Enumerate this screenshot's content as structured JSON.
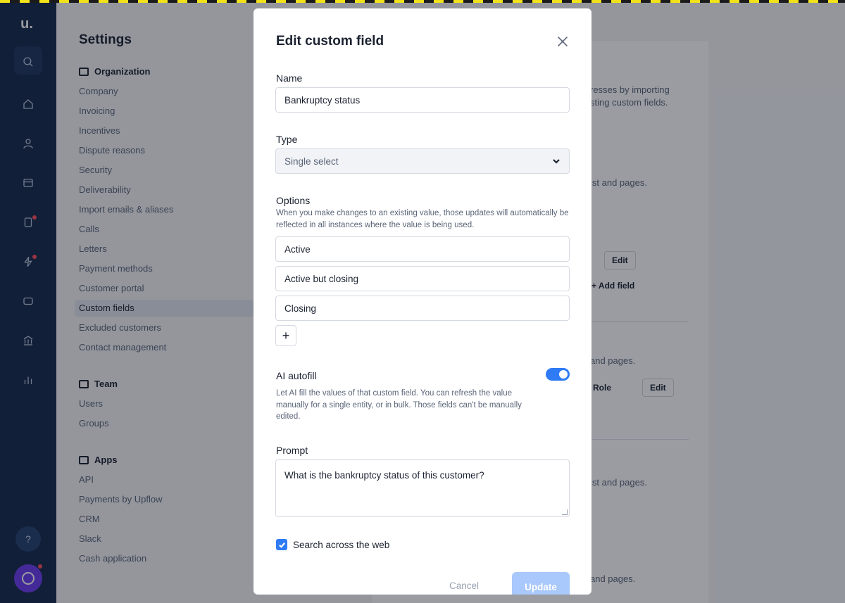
{
  "sidebar": {
    "logo": "u."
  },
  "settings": {
    "title": "Settings",
    "sections": [
      {
        "label": "Organization",
        "items": [
          "Company",
          "Invoicing",
          "Incentives",
          "Dispute reasons",
          "Security",
          "Deliverability",
          "Import emails & aliases",
          "Calls",
          "Letters",
          "Payment methods",
          "Customer portal",
          "Custom fields",
          "Excluded customers",
          "Contact management"
        ]
      },
      {
        "label": "Team",
        "items": [
          "Users",
          "Groups"
        ]
      },
      {
        "label": "Apps",
        "items": [
          "API",
          "Payments by Upflow",
          "CRM",
          "Slack",
          "Cash application"
        ]
      }
    ],
    "active_item": "Custom fields"
  },
  "background_panel": {
    "text_1": "resses by importing",
    "text_2": "sting custom fields.",
    "text_3": "ist and pages.",
    "edit_label": "Edit",
    "add_field_label": "Add field",
    "text_4": "and pages.",
    "role_label": "Role",
    "edit_label_2": "Edit",
    "text_5": "ist and pages.",
    "text_6": "and pages."
  },
  "modal": {
    "title": "Edit custom field",
    "name_label": "Name",
    "name_value": "Bankruptcy status",
    "type_label": "Type",
    "type_value": "Single select",
    "options_label": "Options",
    "options_hint": "When you make changes to an existing value, those updates will automatically be reflected in all instances where the value is being used.",
    "options": [
      "Active",
      "Active but closing",
      "Closing"
    ],
    "add_option_label": "+",
    "ai_autofill_label": "AI autofill",
    "ai_autofill_enabled": true,
    "ai_autofill_hint": "Let AI fill the values of that custom field. You can refresh the value manually for a single entity, or in bulk. Those fields can't be manually edited.",
    "prompt_label": "Prompt",
    "prompt_value": "What is the bankruptcy status of this customer?",
    "search_web_label": "Search across the web",
    "search_web_checked": true,
    "cancel_label": "Cancel",
    "update_label": "Update"
  },
  "colors": {
    "rail": "#15284a",
    "accent": "#2f7bf5",
    "update_disabled": "#a9c8fb",
    "notification_dot": "#ff4b5c",
    "avatar": "#6b3cf0"
  }
}
